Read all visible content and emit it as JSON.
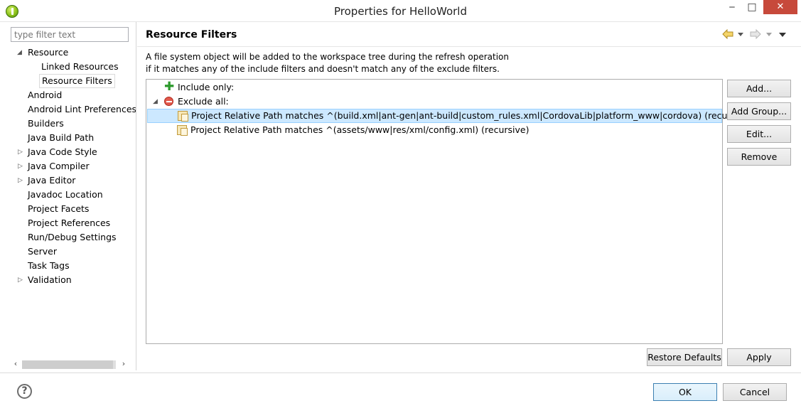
{
  "window": {
    "title": "Properties for HelloWorld",
    "minimize_glyph": "‒",
    "maximize_glyph": "□",
    "close_glyph": "✕"
  },
  "left": {
    "filter_placeholder": "type filter text",
    "tree": [
      {
        "label": "Resource",
        "arrow": "◢",
        "expanded": true
      },
      {
        "label": "Linked Resources"
      },
      {
        "label": "Resource Filters",
        "selected": true
      },
      {
        "label": "Android"
      },
      {
        "label": "Android Lint Preferences"
      },
      {
        "label": "Builders"
      },
      {
        "label": "Java Build Path"
      },
      {
        "label": "Java Code Style",
        "arrow": "▷"
      },
      {
        "label": "Java Compiler",
        "arrow": "▷"
      },
      {
        "label": "Java Editor",
        "arrow": "▷"
      },
      {
        "label": "Javadoc Location"
      },
      {
        "label": "Project Facets"
      },
      {
        "label": "Project References"
      },
      {
        "label": "Run/Debug Settings"
      },
      {
        "label": "Server"
      },
      {
        "label": "Task Tags"
      },
      {
        "label": "Validation",
        "arrow": "▷"
      }
    ],
    "scroll_left": "‹",
    "scroll_right": "›"
  },
  "page": {
    "title": "Resource Filters",
    "description_line1": "A file system object will be added to the workspace tree during the refresh operation",
    "description_line2": "if it matches any of the include filters and doesn't match any of the exclude filters.",
    "filters": {
      "include_label": "Include only:",
      "exclude_arrow": "◢",
      "exclude_label": "Exclude all:",
      "exclude_items": [
        {
          "label": "Project Relative Path matches ^(build.xml|ant-gen|ant-build|custom_rules.xml|CordovaLib|platform_www|cordova)   (recursive)",
          "selected": true
        },
        {
          "label": "Project Relative Path matches ^(assets/www|res/xml/config.xml)   (recursive)"
        }
      ]
    },
    "buttons": {
      "add": "Add...",
      "add_group": "Add Group...",
      "edit": "Edit...",
      "remove": "Remove"
    },
    "restore_defaults": "Restore Defaults",
    "apply": "Apply"
  },
  "dialog": {
    "ok": "OK",
    "cancel": "Cancel",
    "help": "?"
  },
  "colors": {
    "selection_bg": "#cce8ff",
    "selection_border": "#99d1ff",
    "close_button": "#c7493b"
  },
  "icons": [
    "app-icon",
    "back-arrow-icon",
    "forward-arrow-icon",
    "view-menu-icon",
    "plus-icon",
    "exclude-icon",
    "file-filter-icon",
    "help-icon"
  ]
}
